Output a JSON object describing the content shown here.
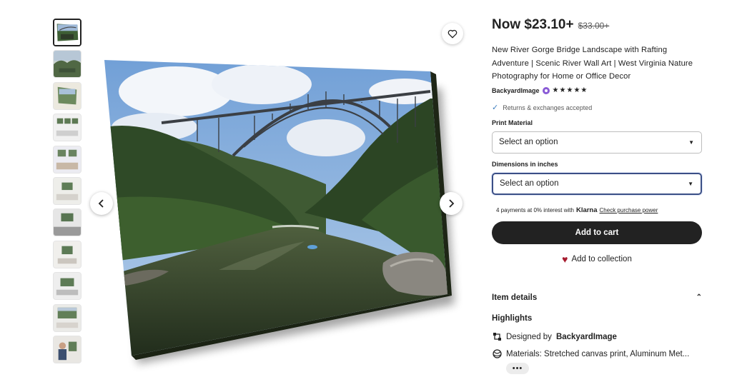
{
  "listing": {
    "price_now": "Now $23.10+",
    "price_original": "$33.00+",
    "title": "New River Gorge Bridge Landscape with Rafting Adventure | Scenic River Wall Art | West Virginia Nature Photography for Home or Office Decor",
    "shop_name": "BackyardImage",
    "rating_stars": "★★★★★",
    "returns_text": "Returns & exchanges accepted"
  },
  "options": {
    "print_material_label": "Print Material",
    "print_material_value": "Select an option",
    "dimensions_label": "Dimensions in inches",
    "dimensions_value": "Select an option"
  },
  "klarna": {
    "text": "4 payments at 0% interest with",
    "brand": "Klarna",
    "link": "Check purchase power"
  },
  "actions": {
    "add_to_cart": "Add to cart",
    "add_to_collection": "Add to collection"
  },
  "details": {
    "section_title": "Item details",
    "highlights_title": "Highlights",
    "designed_by_prefix": "Designed by",
    "designed_by_shop": "BackyardImage",
    "materials": "Materials: Stretched canvas print, Aluminum Met...",
    "more": "•••"
  },
  "gallery": {
    "thumbnail_count": 11,
    "active_index": 0
  },
  "colors": {
    "button_dark": "#222222",
    "heart": "#a61a2e",
    "star_seller": "#8a5bd6",
    "focus_border": "#3b4f86"
  }
}
